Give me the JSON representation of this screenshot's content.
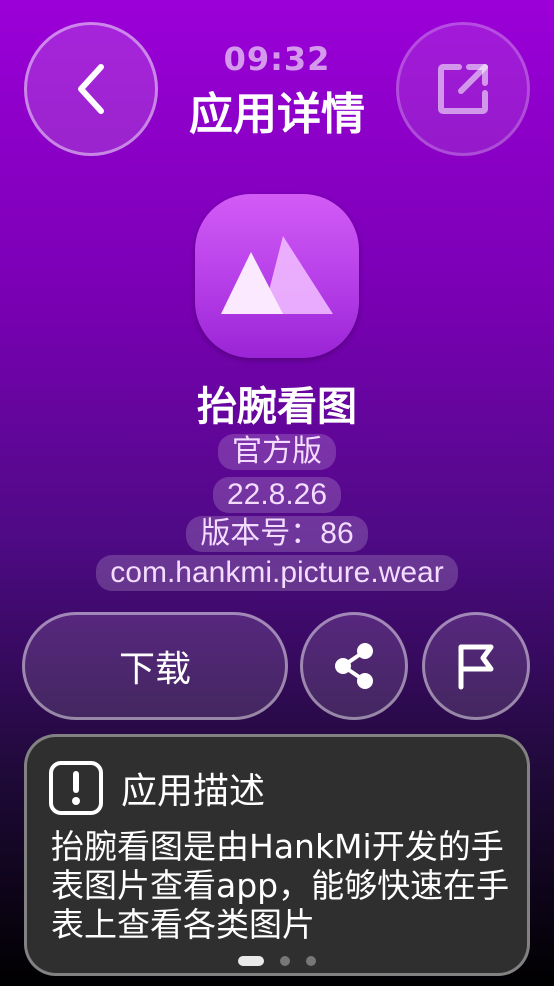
{
  "header": {
    "time": "09:32",
    "title": "应用详情"
  },
  "app": {
    "name": "抬腕看图",
    "edition": "官方版",
    "version": "22.8.26",
    "version_code": "版本号：86",
    "package": "com.hankmi.picture.wear",
    "icon": "mountains-icon",
    "icon_color": "#b63ee8"
  },
  "actions": {
    "download_label": "下载",
    "share_icon": "share-icon",
    "report_icon": "flag-icon"
  },
  "description": {
    "title": "应用描述",
    "text": "抬腕看图是由HankMi开发的手表图片查看app，能够快速在手表上查看各类图片"
  },
  "pager": {
    "count": 3,
    "active": 0
  },
  "colors": {
    "background_top": "#9b00d8",
    "background_bottom": "#000000",
    "card": "#2f2f2f"
  }
}
